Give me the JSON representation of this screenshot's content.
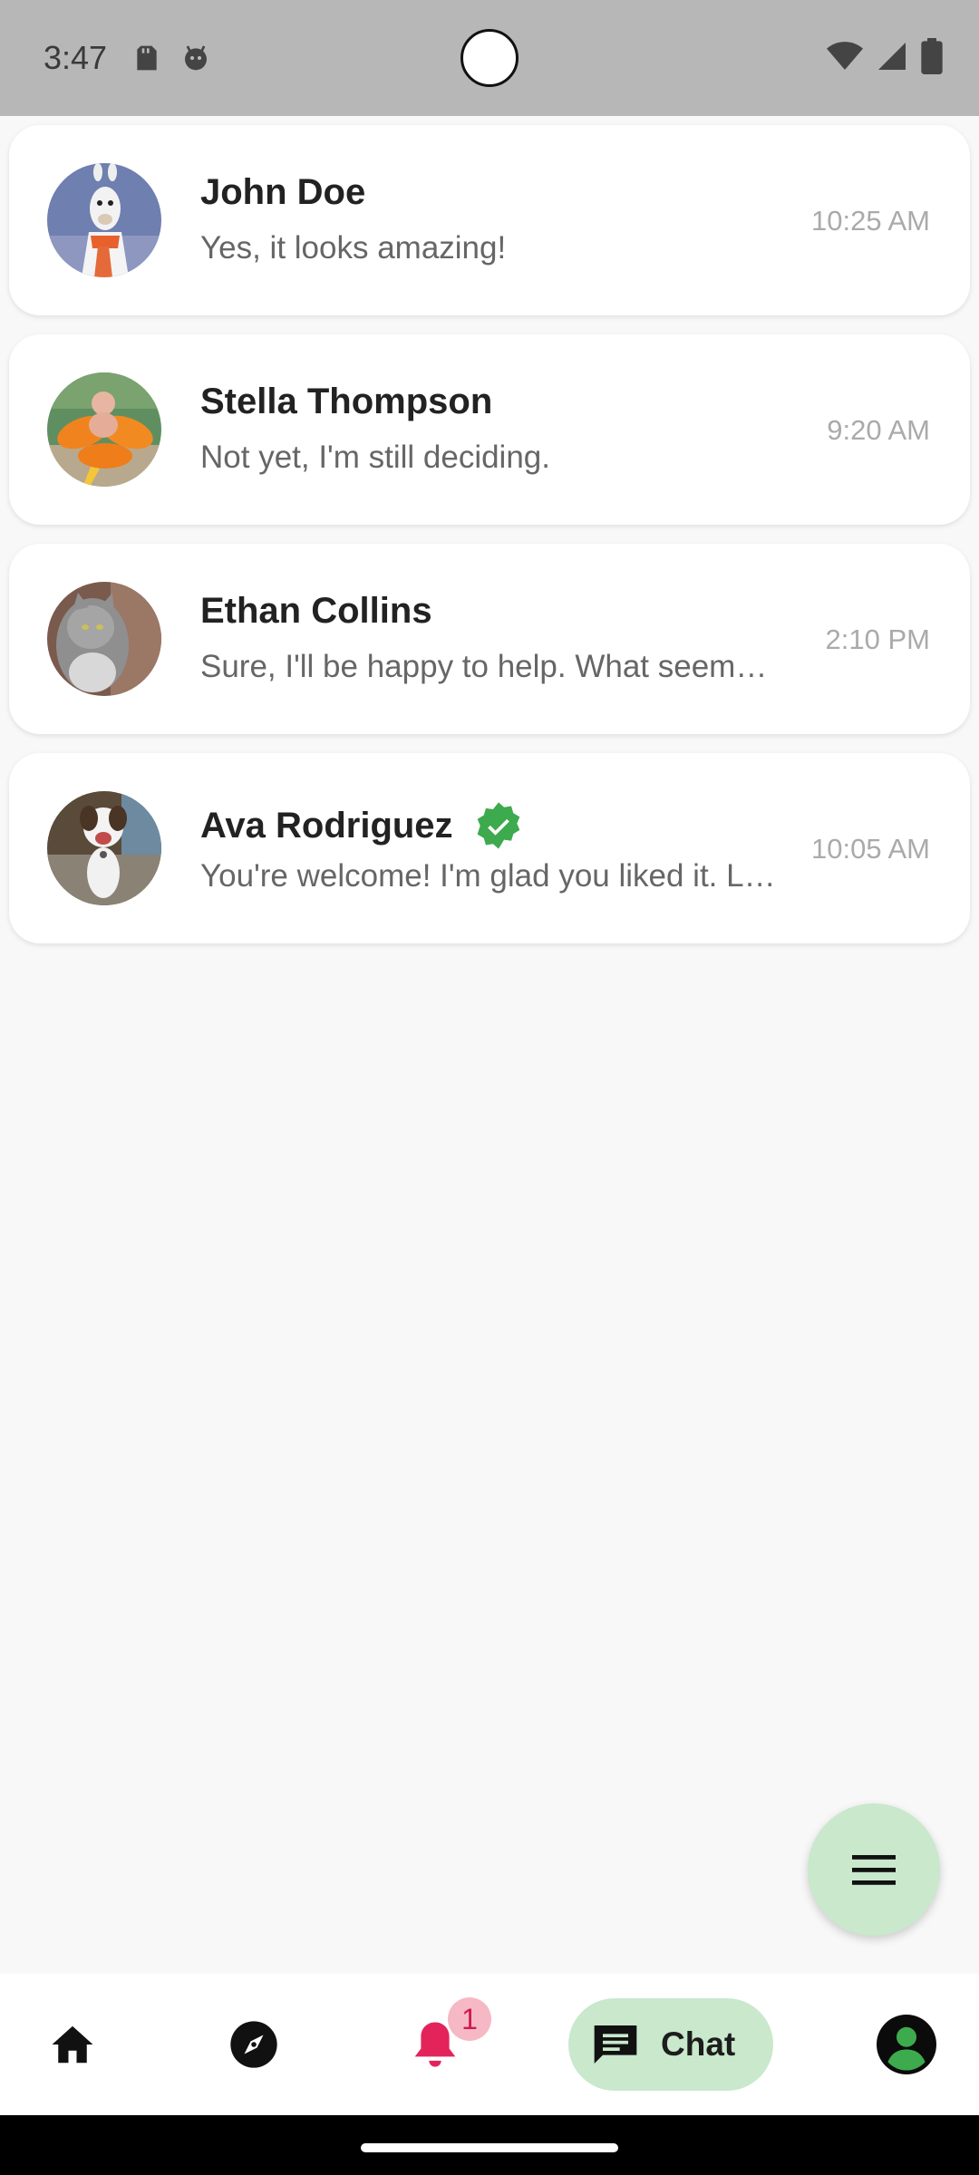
{
  "status_bar": {
    "time": "3:47",
    "icons_left": [
      "sd-card-icon",
      "android-debug-icon"
    ],
    "icons_right": [
      "wifi-icon",
      "cell-signal-icon",
      "battery-icon"
    ]
  },
  "chats": [
    {
      "name": "John Doe",
      "message": "Yes, it looks amazing!",
      "time": "10:25 AM",
      "verified": false,
      "avatar": "llama-avatar"
    },
    {
      "name": "Stella Thompson",
      "message": "Not yet, I'm still deciding.",
      "time": "9:20 AM",
      "verified": false,
      "avatar": "float-avatar"
    },
    {
      "name": "Ethan Collins",
      "message": "Sure, I'll be happy to help. What seems to be the problem?",
      "time": "2:10 PM",
      "verified": false,
      "avatar": "cat-avatar"
    },
    {
      "name": "Ava Rodriguez",
      "message": "You're welcome! I'm glad you liked it. Let me know",
      "time": "10:05 AM",
      "verified": true,
      "avatar": "dog-avatar"
    }
  ],
  "fab": {
    "icon": "menu-icon"
  },
  "bottom_nav": {
    "items": [
      "home-icon",
      "compass-icon",
      "bell-icon",
      "chat-icon",
      "profile-icon"
    ],
    "notification_count": "1",
    "chat_label": "Chat"
  },
  "colors": {
    "accent_green": "#c9e8cc",
    "verified_green": "#3daa4e",
    "notification_red": "#e3245a",
    "profile_green": "#3daa4e"
  }
}
